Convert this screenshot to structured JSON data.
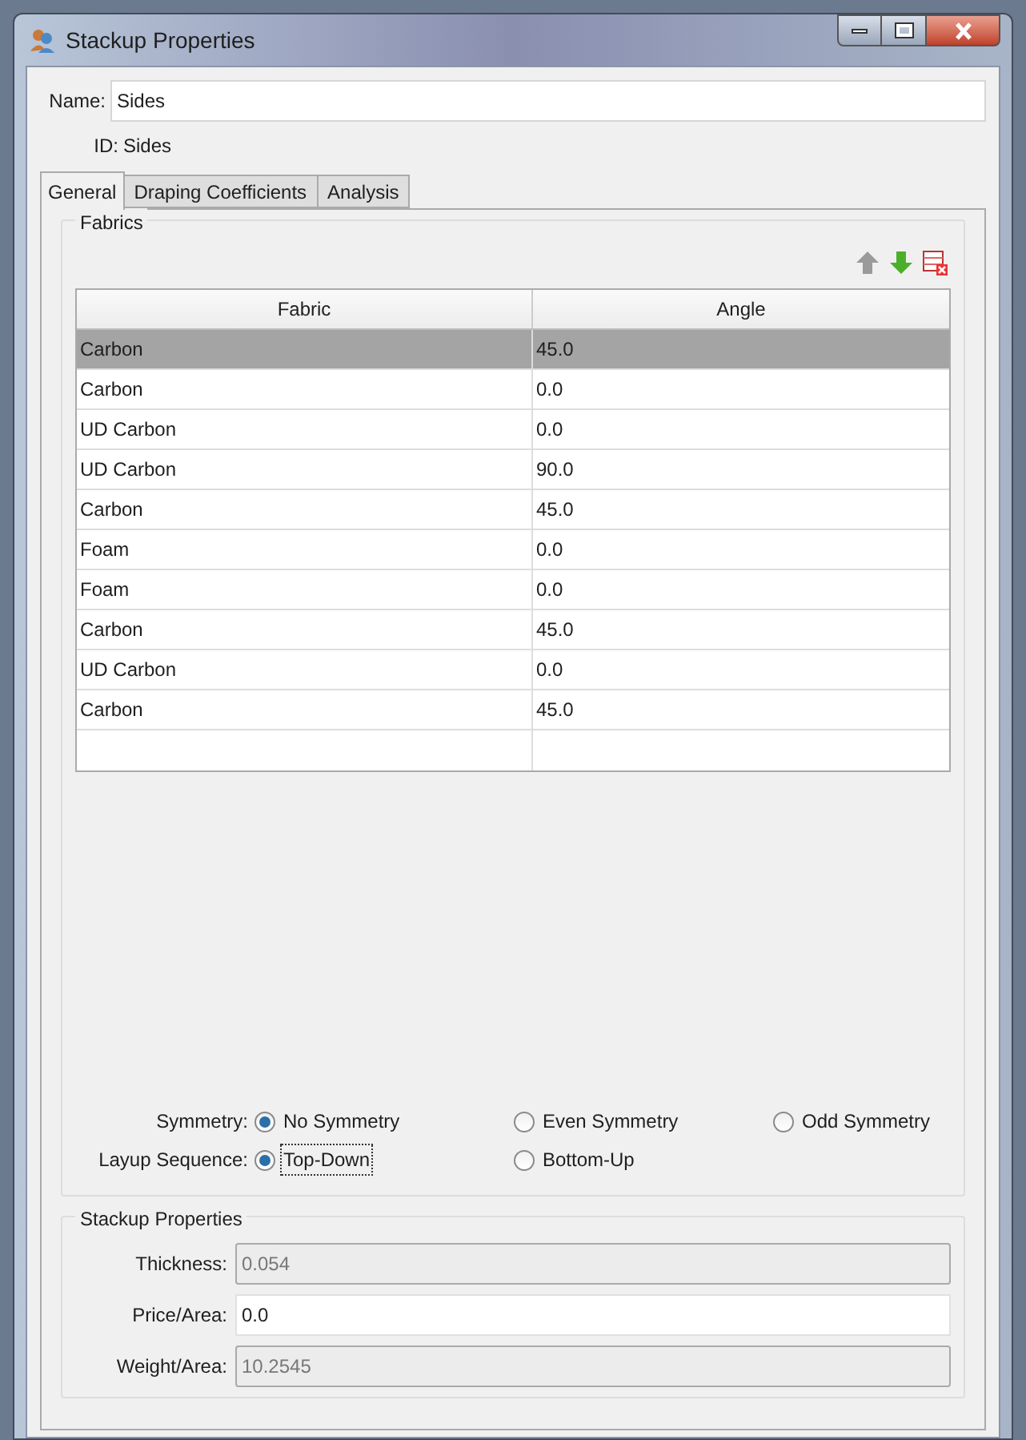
{
  "window": {
    "title": "Stackup Properties"
  },
  "name": {
    "label": "Name:",
    "value": "Sides"
  },
  "id": {
    "label": "ID:",
    "value": "Sides"
  },
  "tabs": [
    {
      "label": "General",
      "selected": true
    },
    {
      "label": "Draping Coefficients",
      "selected": false
    },
    {
      "label": "Analysis",
      "selected": false
    }
  ],
  "fabrics": {
    "title": "Fabrics",
    "toolbar": [
      {
        "kind": "up",
        "disabled": true
      },
      {
        "kind": "down",
        "disabled": false
      },
      {
        "kind": "delete",
        "disabled": false
      }
    ],
    "columns": [
      "Fabric",
      "Angle"
    ],
    "rows": [
      {
        "fabric": "Carbon",
        "angle": "45.0",
        "selected": true
      },
      {
        "fabric": "Carbon",
        "angle": "0.0",
        "selected": false
      },
      {
        "fabric": "UD Carbon",
        "angle": "0.0",
        "selected": false
      },
      {
        "fabric": "UD Carbon",
        "angle": "90.0",
        "selected": false
      },
      {
        "fabric": "Carbon",
        "angle": "45.0",
        "selected": false
      },
      {
        "fabric": "Foam",
        "angle": "0.0",
        "selected": false
      },
      {
        "fabric": "Foam",
        "angle": "0.0",
        "selected": false
      },
      {
        "fabric": "Carbon",
        "angle": "45.0",
        "selected": false
      },
      {
        "fabric": "UD Carbon",
        "angle": "0.0",
        "selected": false
      },
      {
        "fabric": "Carbon",
        "angle": "45.0",
        "selected": false
      }
    ]
  },
  "symmetry": {
    "label": "Symmetry:",
    "options": [
      {
        "label": "No Symmetry",
        "selected": true
      },
      {
        "label": "Even Symmetry",
        "selected": false
      },
      {
        "label": "Odd Symmetry",
        "selected": false
      }
    ]
  },
  "layup_sequence": {
    "label": "Layup Sequence:",
    "options": [
      {
        "label": "Top-Down",
        "selected": true,
        "focused": true
      },
      {
        "label": "Bottom-Up",
        "selected": false,
        "focused": false
      }
    ]
  },
  "stackup_properties": {
    "title": "Stackup Properties",
    "fields": [
      {
        "label": "Thickness:",
        "value": "0.054",
        "disabled": true
      },
      {
        "label": "Price/Area:",
        "value": "0.0",
        "disabled": false
      },
      {
        "label": "Weight/Area:",
        "value": "10.2545",
        "disabled": true
      }
    ]
  }
}
